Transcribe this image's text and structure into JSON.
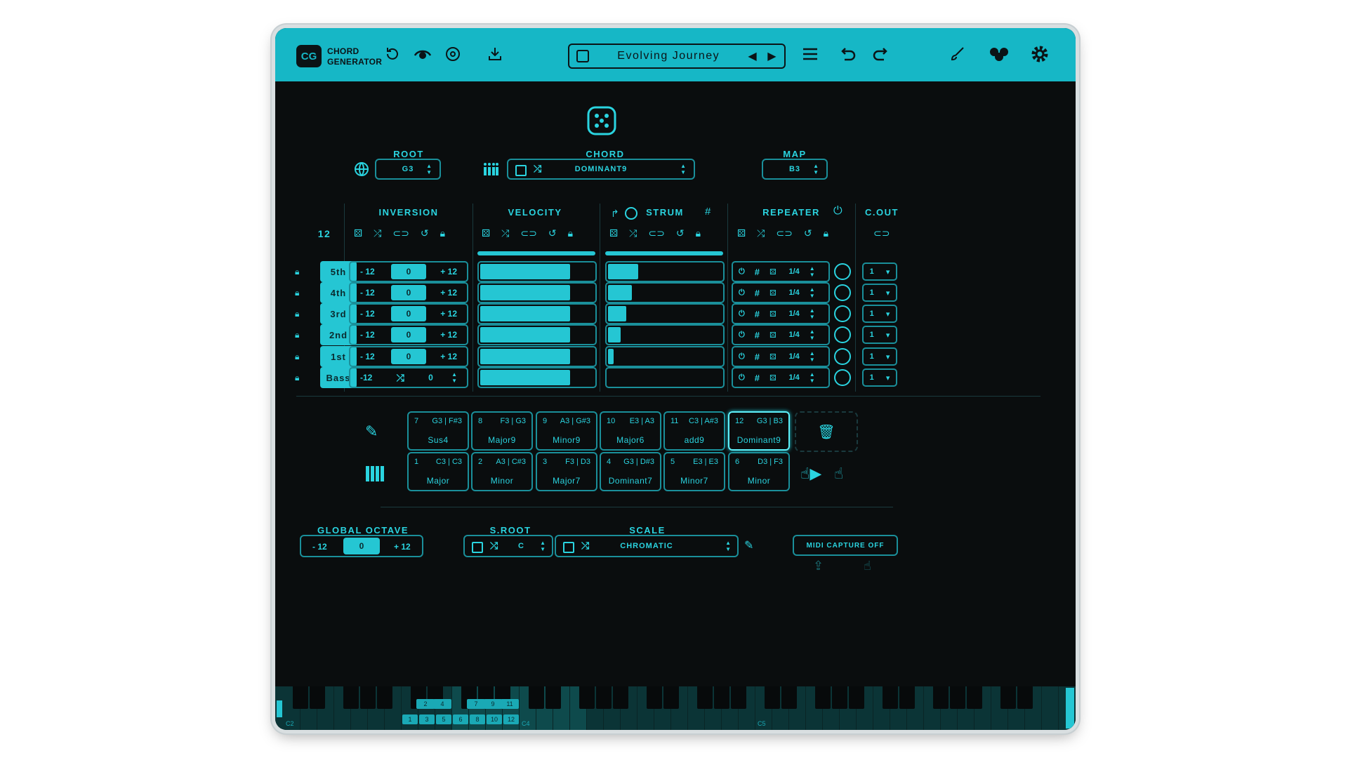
{
  "app": {
    "logo": "CG",
    "title_line1": "CHORD",
    "title_line2": "GENERATOR"
  },
  "toolbar": {
    "preset_name": "Evolving Journey"
  },
  "root": {
    "label": "ROOT",
    "value": "G3"
  },
  "chord": {
    "label": "CHORD",
    "value": "DOMINANT9"
  },
  "map": {
    "label": "MAP",
    "value": "B3"
  },
  "sections": {
    "inversion": "INVERSION",
    "velocity": "VELOCITY",
    "strum": "STRUM",
    "repeater": "REPEATER",
    "cout": "C.OUT",
    "count": "12"
  },
  "voices": [
    {
      "label": "5th",
      "min": "- 12",
      "val": "0",
      "max": "+ 12",
      "velocity": 0.78,
      "strum": 0.26,
      "rate": "1/4",
      "cout": "1"
    },
    {
      "label": "4th",
      "min": "- 12",
      "val": "0",
      "max": "+ 12",
      "velocity": 0.78,
      "strum": 0.21,
      "rate": "1/4",
      "cout": "1"
    },
    {
      "label": "3rd",
      "min": "- 12",
      "val": "0",
      "max": "+ 12",
      "velocity": 0.78,
      "strum": 0.16,
      "rate": "1/4",
      "cout": "1"
    },
    {
      "label": "2nd",
      "min": "- 12",
      "val": "0",
      "max": "+ 12",
      "velocity": 0.78,
      "strum": 0.11,
      "rate": "1/4",
      "cout": "1"
    },
    {
      "label": "1st",
      "min": "- 12",
      "val": "0",
      "max": "+ 12",
      "velocity": 0.78,
      "strum": 0.05,
      "rate": "1/4",
      "cout": "1"
    },
    {
      "label": "Bass",
      "min": "-12",
      "val": "",
      "max": "0",
      "velocity": 0.78,
      "strum": 0.0,
      "rate": "1/4",
      "cout": "1"
    }
  ],
  "pads_top": [
    {
      "num": "7",
      "notes": "G3 | F#3",
      "name": "Sus4"
    },
    {
      "num": "8",
      "notes": "F3 | G3",
      "name": "Major9"
    },
    {
      "num": "9",
      "notes": "A3 | G#3",
      "name": "Minor9"
    },
    {
      "num": "10",
      "notes": "E3 | A3",
      "name": "Major6"
    },
    {
      "num": "11",
      "notes": "C3 | A#3",
      "name": "add9"
    },
    {
      "num": "12",
      "notes": "G3 | B3",
      "name": "Dominant9"
    }
  ],
  "pads_bottom": [
    {
      "num": "1",
      "notes": "C3 | C3",
      "name": "Major"
    },
    {
      "num": "2",
      "notes": "A3 | C#3",
      "name": "Minor"
    },
    {
      "num": "3",
      "notes": "F3 | D3",
      "name": "Major7"
    },
    {
      "num": "4",
      "notes": "G3 | D#3",
      "name": "Dominant7"
    },
    {
      "num": "5",
      "notes": "E3 | E3",
      "name": "Minor7"
    },
    {
      "num": "6",
      "notes": "D3 | F3",
      "name": "Minor"
    }
  ],
  "global_octave": {
    "label": "GLOBAL OCTAVE",
    "min": "- 12",
    "value": "0",
    "max": "+ 12"
  },
  "sroot": {
    "label": "S.ROOT",
    "value": "C"
  },
  "scale": {
    "label": "SCALE",
    "value": "CHROMATIC"
  },
  "midi_capture": {
    "label": "MIDI CAPTURE OFF"
  },
  "keyboard": {
    "octave_labels": [
      "C2",
      "C4",
      "C5"
    ],
    "black_key_numbers": [
      "2",
      "4",
      "7",
      "9",
      "11"
    ],
    "white_key_numbers": [
      "1",
      "3",
      "5",
      "6",
      "8",
      "10",
      "12"
    ]
  },
  "colors": {
    "accent": "#25c6d3",
    "topbar": "#16b7c6",
    "panel": "#0a0d0e"
  }
}
